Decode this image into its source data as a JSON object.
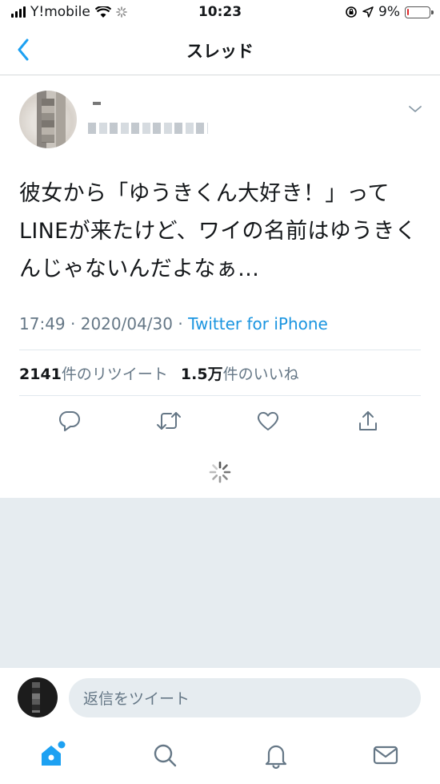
{
  "status_bar": {
    "carrier": "Y!mobile",
    "time": "10:23",
    "battery_percent_text": "9%",
    "battery_level": 0.09,
    "battery_color": "#e0282a"
  },
  "nav": {
    "title": "スレッド",
    "back_icon": "chevron-left-icon"
  },
  "tweet": {
    "text": "彼女から「ゆうきくん大好き！」ってLINEが来たけど、ワイの名前はゆうきくんじゃないんだよなぁ…",
    "time": "17:49",
    "date": "2020/04/30",
    "source": "Twitter for iPhone",
    "separator": "·",
    "retweets_count": "2141",
    "retweets_label": "件のリツイート",
    "likes_count": "1.5万",
    "likes_label": "件のいいね"
  },
  "actions": [
    {
      "name": "reply-icon"
    },
    {
      "name": "retweet-icon"
    },
    {
      "name": "like-icon"
    },
    {
      "name": "share-icon"
    }
  ],
  "reply": {
    "placeholder": "返信をツイート"
  },
  "tabs": [
    {
      "name": "home-icon"
    },
    {
      "name": "search-icon"
    },
    {
      "name": "notifications-icon"
    },
    {
      "name": "messages-icon"
    }
  ],
  "colors": {
    "accent": "#1da1f2",
    "link": "#1b95e0",
    "muted": "#657786",
    "background_grey": "#e6ecf0"
  }
}
